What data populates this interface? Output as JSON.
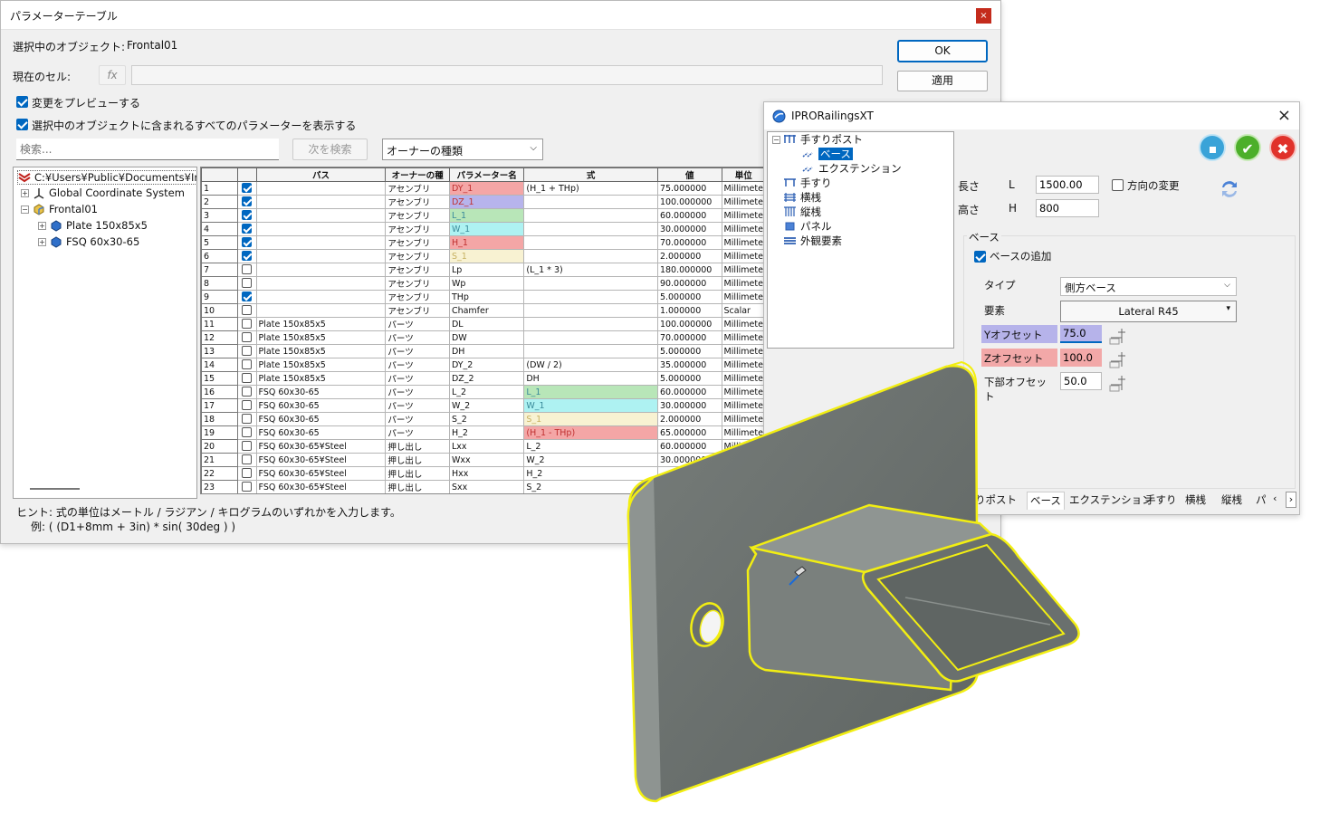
{
  "pt": {
    "title": "パラメーターテーブル",
    "close": "×",
    "sel_obj_label": "選択中のオブジェクト:",
    "sel_obj_value": "Frontal01",
    "cur_cell_label": "現在のセル:",
    "fx": "fx",
    "ok": "OK",
    "apply": "適用",
    "preview": "変更をプレビューする",
    "show_all": "選択中のオブジェクトに含まれるすべてのパラメーターを表示する",
    "search_placeholder": "検索...",
    "find_next": "次を検索",
    "owner_type": "オーナーの種類",
    "tree": {
      "root": "C:¥Users¥Public¥Documents¥Iron",
      "gcs": "Global Coordinate System",
      "frontal": "Frontal01",
      "plate": "Plate 150x85x5",
      "fsq": "FSQ 60x30-65"
    },
    "hint1": "ヒント: 式の単位はメートル / ラジアン / キログラムのいずれかを入力します。",
    "hint2": "例: ( (D1+8mm + 3in) * sin( 30deg ) )",
    "columns": [
      "",
      "",
      "パス",
      "オーナーの種",
      "パラメーター名",
      "式",
      "値",
      "単位"
    ],
    "rows": [
      [
        "1",
        true,
        "",
        "アセンブリ",
        "DY_1",
        "(H_1 + THp)",
        "75.000000",
        "Millimete"
      ],
      [
        "2",
        true,
        "",
        "アセンブリ",
        "DZ_1",
        "",
        "100.000000",
        "Millimete"
      ],
      [
        "3",
        true,
        "",
        "アセンブリ",
        "L_1",
        "",
        "60.000000",
        "Millimete"
      ],
      [
        "4",
        true,
        "",
        "アセンブリ",
        "W_1",
        "",
        "30.000000",
        "Millimete"
      ],
      [
        "5",
        true,
        "",
        "アセンブリ",
        "H_1",
        "",
        "70.000000",
        "Millimete"
      ],
      [
        "6",
        true,
        "",
        "アセンブリ",
        "S_1",
        "",
        "2.000000",
        "Millimete"
      ],
      [
        "7",
        false,
        "",
        "アセンブリ",
        "Lp",
        "(L_1 * 3)",
        "180.000000",
        "Millimete"
      ],
      [
        "8",
        false,
        "",
        "アセンブリ",
        "Wp",
        "",
        "90.000000",
        "Millimete"
      ],
      [
        "9",
        true,
        "",
        "アセンブリ",
        "THp",
        "",
        "5.000000",
        "Millimete"
      ],
      [
        "10",
        false,
        "",
        "アセンブリ",
        "Chamfer",
        "",
        "1.000000",
        "Scalar"
      ],
      [
        "11",
        false,
        "Plate 150x85x5",
        "パーツ",
        "DL",
        "",
        "100.000000",
        "Millimete"
      ],
      [
        "12",
        false,
        "Plate 150x85x5",
        "パーツ",
        "DW",
        "",
        "70.000000",
        "Millimete"
      ],
      [
        "13",
        false,
        "Plate 150x85x5",
        "パーツ",
        "DH",
        "",
        "5.000000",
        "Millimete"
      ],
      [
        "14",
        false,
        "Plate 150x85x5",
        "パーツ",
        "DY_2",
        "(DW / 2)",
        "35.000000",
        "Millimete"
      ],
      [
        "15",
        false,
        "Plate 150x85x5",
        "パーツ",
        "DZ_2",
        "DH",
        "5.000000",
        "Millimete"
      ],
      [
        "16",
        false,
        "FSQ 60x30-65",
        "パーツ",
        "L_2",
        "L_1",
        "60.000000",
        "Millimete"
      ],
      [
        "17",
        false,
        "FSQ 60x30-65",
        "パーツ",
        "W_2",
        "W_1",
        "30.000000",
        "Millimete"
      ],
      [
        "18",
        false,
        "FSQ 60x30-65",
        "パーツ",
        "S_2",
        "S_1",
        "2.000000",
        "Millimete"
      ],
      [
        "19",
        false,
        "FSQ 60x30-65",
        "パーツ",
        "H_2",
        "(H_1 - THp)",
        "65.000000",
        "Millimete"
      ],
      [
        "20",
        false,
        "FSQ 60x30-65¥Steel",
        "押し出し",
        "Lxx",
        "L_2",
        "60.000000",
        "Millimete"
      ],
      [
        "21",
        false,
        "FSQ 60x30-65¥Steel",
        "押し出し",
        "Wxx",
        "W_2",
        "30.000000",
        ""
      ],
      [
        "22",
        false,
        "FSQ 60x30-65¥Steel",
        "押し出し",
        "Hxx",
        "H_2",
        "",
        ""
      ],
      [
        "23",
        false,
        "FSQ 60x30-65¥Steel",
        "押し出し",
        "Sxx",
        "S_2",
        "",
        ""
      ]
    ]
  },
  "rw": {
    "title": "IPRORailingsXT",
    "close": "×",
    "tree": [
      "手すりポスト",
      "ベース",
      "エクステンション",
      "手すり",
      "横桟",
      "縦桟",
      "パネル",
      "外観要素"
    ],
    "len_label": "長さ",
    "len_sym": "L",
    "len_val": "1500.00",
    "hei_label": "高さ",
    "hei_sym": "H",
    "hei_val": "800",
    "dir_change": "方向の変更",
    "base_group": "ベース",
    "base_add": "ベースの追加",
    "type_label": "タイプ",
    "type_val": "側方ベース",
    "elem_label": "要素",
    "elem_val": "Lateral R45",
    "yoff_label": "Yオフセット",
    "yoff_val": "75.0",
    "zoff_label": "Zオフセット",
    "zoff_val": "100.0",
    "boff_label": "下部オフセット",
    "boff_val": "50.0",
    "tabs": [
      "りポスト",
      "ベース",
      "エクステンション",
      "手すり",
      "横桟",
      "縦桟",
      "パ"
    ],
    "colors": {
      "blue": "#3aa3d8",
      "green": "#4caf2a",
      "red": "#e0322b",
      "yoff_bg": "#b6b3ea",
      "zoff_bg": "#f2a8a8"
    }
  }
}
